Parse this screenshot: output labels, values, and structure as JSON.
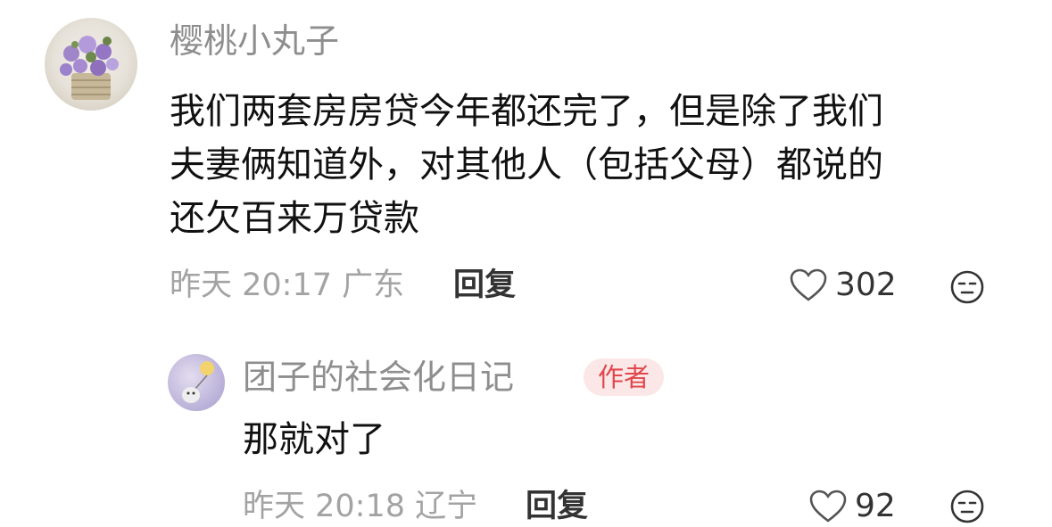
{
  "comment": {
    "username": "樱桃小丸子",
    "lines": [
      "我们两套房房贷今年都还完了，但是除了我们",
      "夫妻俩知道外，对其他人（包括父母）都说的",
      "还欠百来万贷款"
    ],
    "meta": "昨天 20:17 广东",
    "reply_label": "回复",
    "like_count": "302",
    "avatar_icon": "purple-flower-bouquet",
    "like_icon": "heart-outline-icon",
    "react_icon": "neutral-face-icon"
  },
  "reply": {
    "username": "团子的社会化日记",
    "badge": "作者",
    "text": "那就对了",
    "meta": "昨天 20:18 辽宁",
    "reply_label": "回复",
    "like_count": "92",
    "avatar_icon": "balloon-character",
    "like_icon": "heart-outline-icon",
    "react_icon": "neutral-face-icon"
  },
  "colors": {
    "username": "#8e8e8e",
    "body_text": "#111111",
    "meta_text": "#a3a3a3",
    "badge_bg": "#fbe7e7",
    "badge_text": "#e0464a"
  }
}
